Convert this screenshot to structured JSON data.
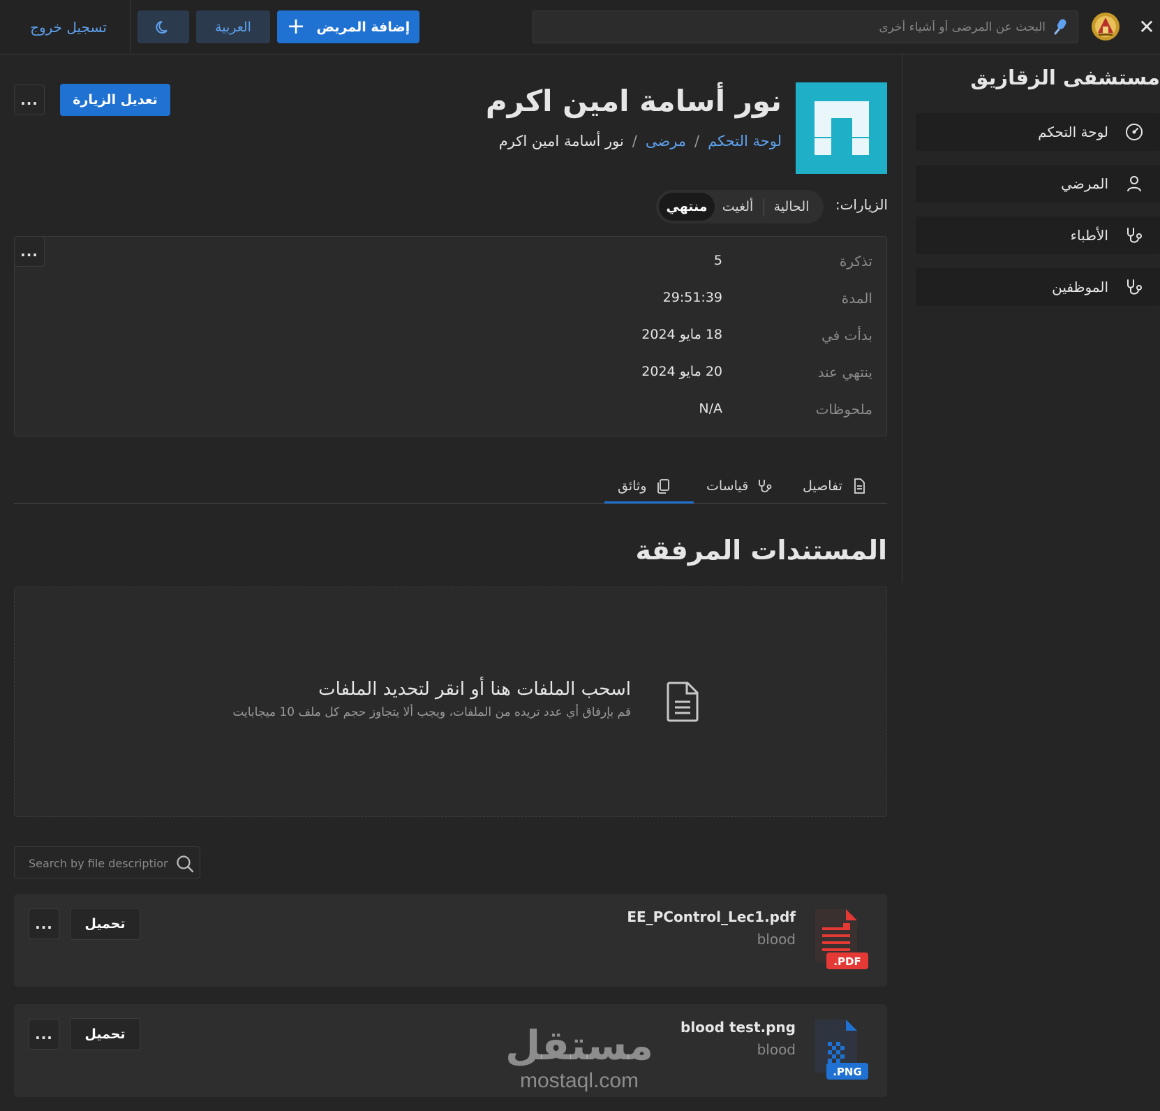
{
  "topbar": {
    "close_icon": "close-icon",
    "logo_icon": "university-seal-logo",
    "search_placeholder": "البحث عن المرضى أو أشياء أخرى",
    "search_icon": "mic-icon",
    "add_patient_label": "إضافة المريض",
    "add_patient_icon": "plus-icon",
    "language_label": "العربية",
    "dark_mode_icon": "moon-icon",
    "logout_label": "تسجيل خروج"
  },
  "sidebar": {
    "title": "مستشفى الزقازيق",
    "items": [
      {
        "label": "لوحة التحكم",
        "icon": "dashboard-gauge-icon"
      },
      {
        "label": "المرضي",
        "icon": "user-icon"
      },
      {
        "label": "الأطباء",
        "icon": "stethoscope-icon"
      },
      {
        "label": "الموظفين",
        "icon": "stethoscope-icon"
      }
    ]
  },
  "header": {
    "patient_name": "نور أسامة امين اكرم",
    "breadcrumb": {
      "dashboard": "لوحة التحكم",
      "separator": "/",
      "patients": "مرضى",
      "current": "نور أسامة امين اكرم"
    },
    "edit_visit_label": "تعديل الزيارة",
    "more_label": "...",
    "avatar_color": "#1fb0c7"
  },
  "visits": {
    "label": "الزيارات:",
    "options": [
      "الحالية",
      "ألغيت",
      "منتهي"
    ],
    "selected": "منتهي"
  },
  "details": {
    "rows": [
      {
        "label": "تذكرة",
        "value": "5"
      },
      {
        "label": "المدة",
        "value": "29:51:39"
      },
      {
        "label": "بدأت في",
        "value": "18 مايو 2024"
      },
      {
        "label": "ينتهي عند",
        "value": "20 مايو 2024"
      },
      {
        "label": "ملحوظات",
        "value": "N/A"
      }
    ]
  },
  "tabs": {
    "details": "تفاصيل",
    "measurements": "قياسات",
    "documents": "وثائق",
    "active": "وثائق"
  },
  "documents": {
    "title": "المستندات المرفقة",
    "dropzone_title": "اسحب الملفات هنا أو انقر لتحديد الملفات",
    "dropzone_subtitle": "قم بإرفاق أي عدد تريده من الملفات، ويجب ألا يتجاوز حجم كل ملف 10 ميجابايت",
    "search_placeholder": "Search by file description",
    "download_label": "تحميل",
    "files": [
      {
        "name": "EE_PControl_Lec1.pdf",
        "description": "blood",
        "type_badge": ".PDF",
        "badge_color": "#e53935"
      },
      {
        "name": "blood test.png",
        "description": "blood",
        "type_badge": ".PNG",
        "badge_color": "#1f72d1"
      }
    ]
  },
  "watermark": {
    "arabic": "مستقل",
    "latin": "mostaql.com"
  },
  "colors": {
    "accent": "#1f72d1",
    "link": "#5ea1ee",
    "background": "#252525"
  }
}
